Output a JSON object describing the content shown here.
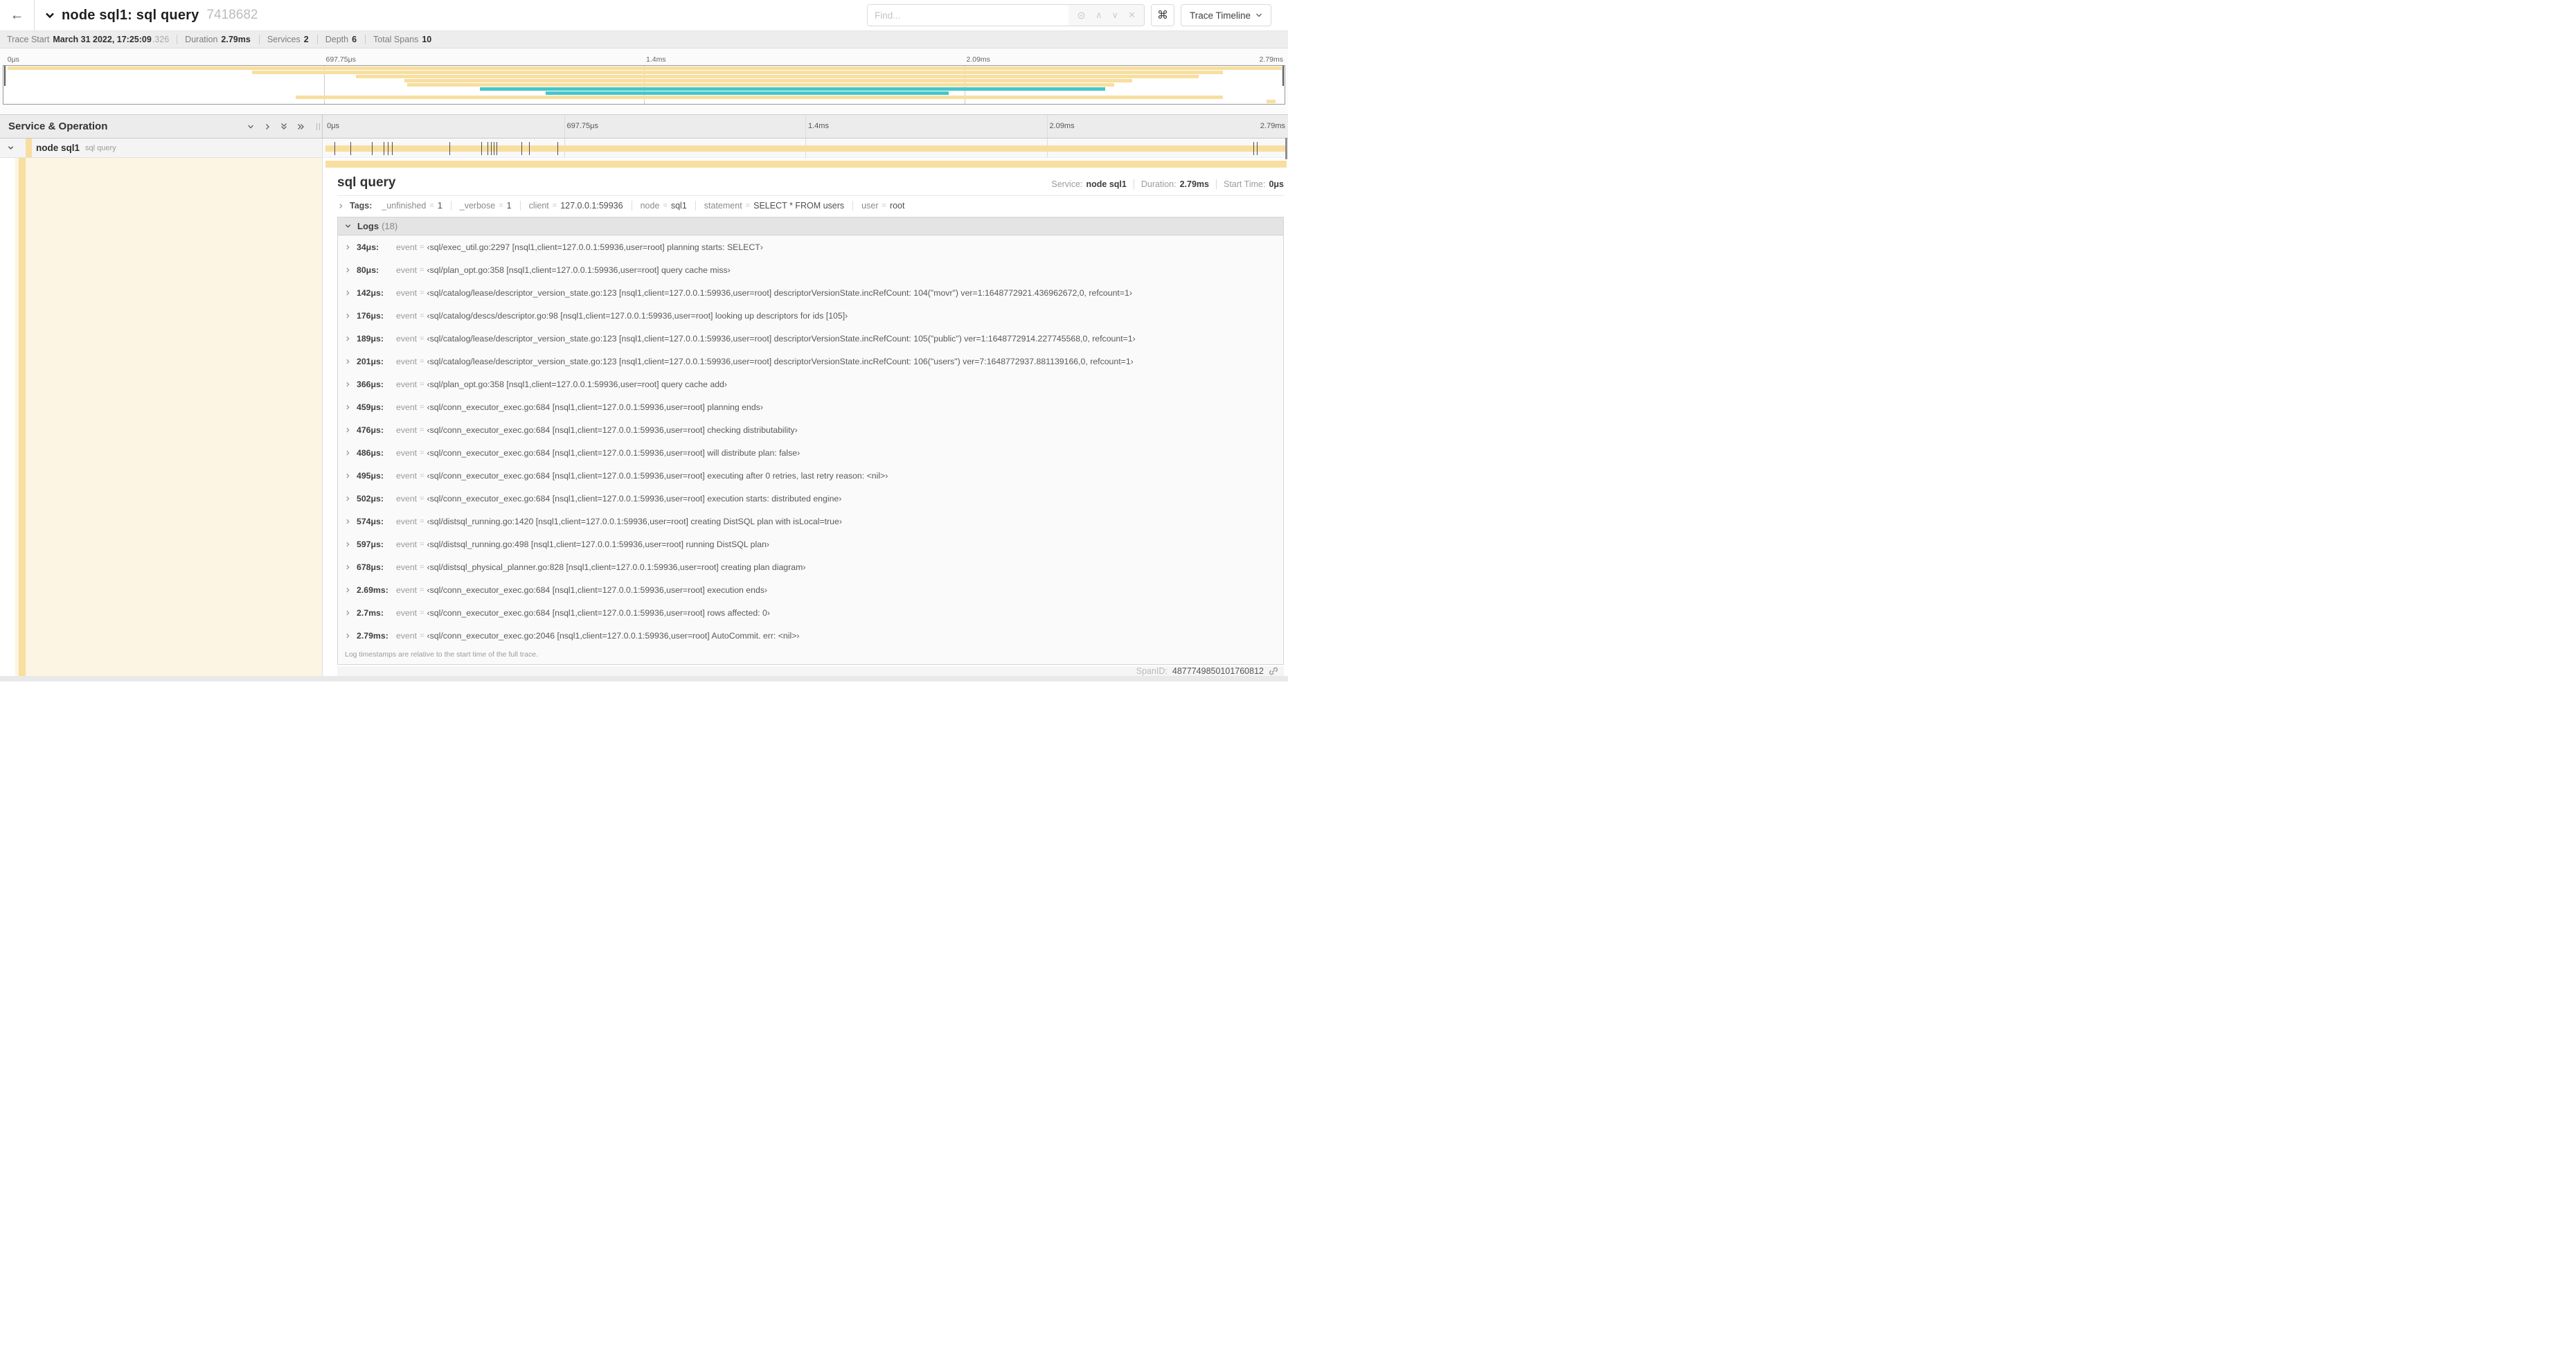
{
  "icons": {
    "back": "←",
    "command": "⌘",
    "prev": "∧",
    "next": "∨",
    "clear": "✕"
  },
  "header": {
    "title": "node sql1: sql query",
    "trace_id": "7418682",
    "find_placeholder": "Find...",
    "view_selector": "Trace Timeline"
  },
  "trace_stats": [
    {
      "label": "Trace Start",
      "value": "March 31 2022, 17:25:09",
      "suffix": ".326"
    },
    {
      "label": "Duration",
      "value": "2.79ms"
    },
    {
      "label": "Services",
      "value": "2"
    },
    {
      "label": "Depth",
      "value": "6"
    },
    {
      "label": "Total Spans",
      "value": "10"
    }
  ],
  "minimap": {
    "labels": [
      {
        "text": "0μs",
        "l": 0.15
      },
      {
        "text": "697.75μs",
        "l": 25
      },
      {
        "text": "1.4ms",
        "l": 50
      },
      {
        "text": "2.09ms",
        "l": 75
      },
      {
        "text": "2.79ms",
        "l": 100
      }
    ],
    "spans": [
      {
        "l": 0.3,
        "w": 99.5,
        "c": "tan"
      },
      {
        "l": 19.4,
        "w": 75.8,
        "c": "tan"
      },
      {
        "l": 27.5,
        "w": 65.8,
        "c": "tan"
      },
      {
        "l": 31.3,
        "w": 56.8,
        "c": "tan"
      },
      {
        "l": 31.5,
        "w": 55.2,
        "c": "tan"
      },
      {
        "l": 37.2,
        "w": 48.8,
        "c": "teal"
      },
      {
        "l": 42.3,
        "w": 31.5,
        "c": "teal"
      },
      {
        "l": 22.8,
        "w": 72.4,
        "c": "tan"
      },
      {
        "l": 98.6,
        "w": 0.7,
        "c": "tan"
      }
    ]
  },
  "timeline": {
    "left_header": "Service & Operation",
    "ticks": [
      {
        "text": "0μs",
        "l": 0.15
      },
      {
        "text": "697.75μs",
        "l": 25
      },
      {
        "text": "1.4ms",
        "l": 50
      },
      {
        "text": "2.09ms",
        "l": 75
      },
      {
        "text": "2.79ms",
        "l": 100
      }
    ],
    "span_row": {
      "service": "node sql1",
      "operation": "sql query"
    },
    "log_markers": [
      {
        "l": 1.22
      },
      {
        "l": 2.87
      },
      {
        "l": 5.09
      },
      {
        "l": 6.31
      },
      {
        "l": 6.77
      },
      {
        "l": 7.2
      },
      {
        "l": 13.12
      },
      {
        "l": 16.45
      },
      {
        "l": 17.06
      },
      {
        "l": 17.42
      },
      {
        "l": 17.74
      },
      {
        "l": 18.0
      },
      {
        "l": 20.57
      },
      {
        "l": 21.4
      },
      {
        "l": 24.3
      },
      {
        "l": 96.4
      },
      {
        "l": 96.8
      },
      {
        "l": 99.85
      }
    ]
  },
  "detail": {
    "operation": "sql query",
    "summary": [
      {
        "label": "Service:",
        "value": "node sql1"
      },
      {
        "label": "Duration:",
        "value": "2.79ms"
      },
      {
        "label": "Start Time:",
        "value": "0μs"
      }
    ],
    "tags": {
      "label": "Tags:",
      "eq": "=",
      "items": [
        {
          "key": "_unfinished",
          "value": "1"
        },
        {
          "key": "_verbose",
          "value": "1"
        },
        {
          "key": "client",
          "value": "127.0.0.1:59936"
        },
        {
          "key": "node",
          "value": "sql1"
        },
        {
          "key": "statement",
          "value": "SELECT * FROM users"
        },
        {
          "key": "user",
          "value": "root"
        }
      ]
    },
    "logs": {
      "label": "Logs",
      "count": "(18)",
      "eq": "=",
      "rows": [
        {
          "time": "34μs:",
          "field": "event",
          "value": "‹sql/exec_util.go:2297 [nsql1,client=127.0.0.1:59936,user=root] planning starts: SELECT›"
        },
        {
          "time": "80μs:",
          "field": "event",
          "value": "‹sql/plan_opt.go:358 [nsql1,client=127.0.0.1:59936,user=root] query cache miss›"
        },
        {
          "time": "142μs:",
          "field": "event",
          "value": "‹sql/catalog/lease/descriptor_version_state.go:123 [nsql1,client=127.0.0.1:59936,user=root] descriptorVersionState.incRefCount: 104(\"movr\") ver=1:1648772921.436962672,0, refcount=1›"
        },
        {
          "time": "176μs:",
          "field": "event",
          "value": "‹sql/catalog/descs/descriptor.go:98 [nsql1,client=127.0.0.1:59936,user=root] looking up descriptors for ids [105]›"
        },
        {
          "time": "189μs:",
          "field": "event",
          "value": "‹sql/catalog/lease/descriptor_version_state.go:123 [nsql1,client=127.0.0.1:59936,user=root] descriptorVersionState.incRefCount: 105(\"public\") ver=1:1648772914.227745568,0, refcount=1›"
        },
        {
          "time": "201μs:",
          "field": "event",
          "value": "‹sql/catalog/lease/descriptor_version_state.go:123 [nsql1,client=127.0.0.1:59936,user=root] descriptorVersionState.incRefCount: 106(\"users\") ver=7:1648772937.881139166,0, refcount=1›"
        },
        {
          "time": "366μs:",
          "field": "event",
          "value": "‹sql/plan_opt.go:358 [nsql1,client=127.0.0.1:59936,user=root] query cache add›"
        },
        {
          "time": "459μs:",
          "field": "event",
          "value": "‹sql/conn_executor_exec.go:684 [nsql1,client=127.0.0.1:59936,user=root] planning ends›"
        },
        {
          "time": "476μs:",
          "field": "event",
          "value": "‹sql/conn_executor_exec.go:684 [nsql1,client=127.0.0.1:59936,user=root] checking distributability›"
        },
        {
          "time": "486μs:",
          "field": "event",
          "value": "‹sql/conn_executor_exec.go:684 [nsql1,client=127.0.0.1:59936,user=root] will distribute plan: false›"
        },
        {
          "time": "495μs:",
          "field": "event",
          "value": "‹sql/conn_executor_exec.go:684 [nsql1,client=127.0.0.1:59936,user=root] executing after 0 retries, last retry reason: <nil>›"
        },
        {
          "time": "502μs:",
          "field": "event",
          "value": "‹sql/conn_executor_exec.go:684 [nsql1,client=127.0.0.1:59936,user=root] execution starts: distributed engine›"
        },
        {
          "time": "574μs:",
          "field": "event",
          "value": "‹sql/distsql_running.go:1420 [nsql1,client=127.0.0.1:59936,user=root] creating DistSQL plan with isLocal=true›"
        },
        {
          "time": "597μs:",
          "field": "event",
          "value": "‹sql/distsql_running.go:498 [nsql1,client=127.0.0.1:59936,user=root] running DistSQL plan›"
        },
        {
          "time": "678μs:",
          "field": "event",
          "value": "‹sql/distsql_physical_planner.go:828 [nsql1,client=127.0.0.1:59936,user=root] creating plan diagram›"
        },
        {
          "time": "2.69ms:",
          "field": "event",
          "value": "‹sql/conn_executor_exec.go:684 [nsql1,client=127.0.0.1:59936,user=root] execution ends›"
        },
        {
          "time": "2.7ms:",
          "field": "event",
          "value": "‹sql/conn_executor_exec.go:684 [nsql1,client=127.0.0.1:59936,user=root] rows affected: 0›"
        },
        {
          "time": "2.79ms:",
          "field": "event",
          "value": "‹sql/conn_executor_exec.go:2046 [nsql1,client=127.0.0.1:59936,user=root] AutoCommit. err: <nil>›"
        }
      ],
      "footnote": "Log timestamps are relative to the start time of the full trace."
    },
    "span_id_label": "SpanID:",
    "span_id": "4877749850101760812"
  },
  "colors": {
    "span_tan": "#f8de9f",
    "span_teal": "#46c6ca"
  }
}
